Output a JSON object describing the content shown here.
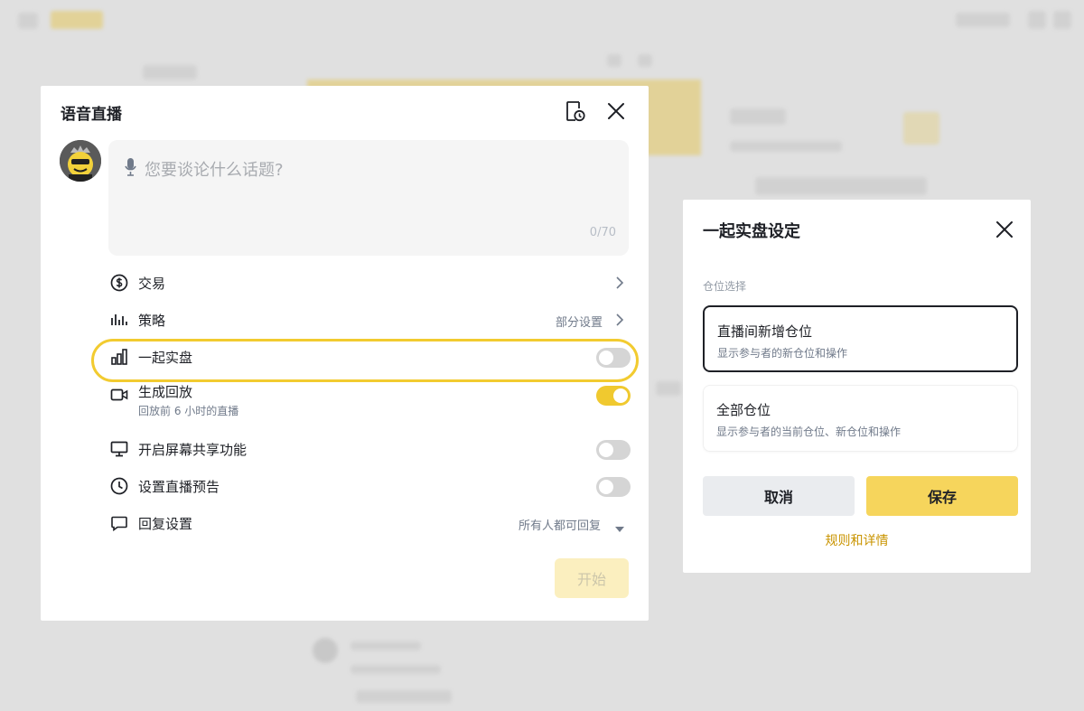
{
  "main_modal": {
    "title": "语音直播",
    "topic": {
      "placeholder": "您要谈论什么话题?",
      "counter": "0/70"
    },
    "rows": {
      "trade": {
        "label": "交易"
      },
      "strategy": {
        "label": "策略",
        "value": "部分设置"
      },
      "live_trading": {
        "label": "一起实盘",
        "enabled": false
      },
      "replay": {
        "label": "生成回放",
        "sub": "回放前 6 小时的直播",
        "enabled": true
      },
      "screen_share": {
        "label": "开启屏幕共享功能",
        "enabled": false
      },
      "preview": {
        "label": "设置直播预告",
        "enabled": false
      },
      "reply": {
        "label": "回复设置",
        "value": "所有人都可回复"
      }
    },
    "start_label": "开始"
  },
  "settings_modal": {
    "title": "一起实盘设定",
    "section_label": "仓位选择",
    "options": [
      {
        "title": "直播间新增仓位",
        "desc": "显示参与者的新仓位和操作",
        "selected": true
      },
      {
        "title": "全部仓位",
        "desc": "显示参与者的当前仓位、新仓位和操作",
        "selected": false
      }
    ],
    "cancel_label": "取消",
    "save_label": "保存",
    "rules_link": "规则和详情"
  },
  "colors": {
    "accent": "#f0c92f",
    "save_button": "#f6d55c",
    "link": "#c99400",
    "text_primary": "#1e2026",
    "text_secondary": "#707a8a"
  },
  "icons": [
    "history-icon",
    "close-icon",
    "avatar",
    "microphone-icon",
    "dollar-circle-icon",
    "bar-chart-icon",
    "signal-bars-icon",
    "video-camera-icon",
    "monitor-icon",
    "clock-icon",
    "chat-bubble-icon",
    "chevron-right-icon",
    "caret-down-icon"
  ]
}
